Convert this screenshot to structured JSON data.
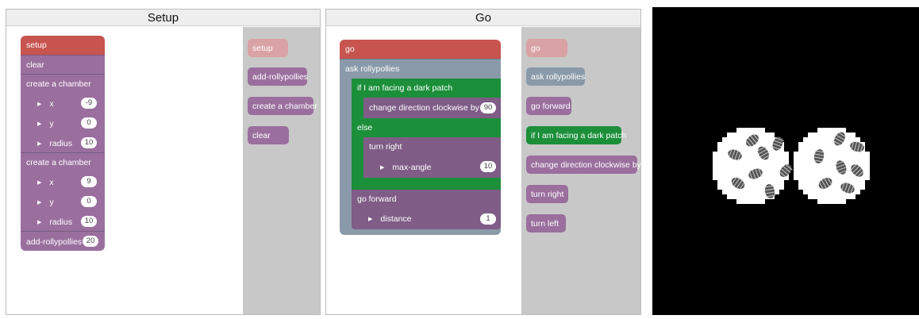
{
  "setup_pane": {
    "title": "Setup",
    "blocks": {
      "hat": "setup",
      "clear": "clear",
      "chamber1": {
        "label": "create a chamber",
        "x_label": "x",
        "x_val": "-9",
        "y_label": "y",
        "y_val": "0",
        "r_label": "radius",
        "r_val": "10"
      },
      "chamber2": {
        "label": "create a chamber",
        "x_label": "x",
        "x_val": "9",
        "y_label": "y",
        "y_val": "0",
        "r_label": "radius",
        "r_val": "10"
      },
      "add": {
        "label": "add-rollypollies",
        "val": "20"
      }
    },
    "flyout": [
      "setup",
      "add-rollypollies",
      "create a chamber",
      "clear"
    ]
  },
  "go_pane": {
    "title": "Go",
    "blocks": {
      "hat": "go",
      "ask": "ask rollypollies",
      "if": "if I am facing a dark patch",
      "change": {
        "label": "change direction clockwise by",
        "val": "90"
      },
      "else": "else",
      "turn_right": "turn right",
      "max_angle": {
        "label": "max-angle",
        "val": "10"
      },
      "forward": "go forward",
      "distance": {
        "label": "distance",
        "val": "1"
      }
    },
    "flyout": [
      "go",
      "ask rollypollies",
      "go forward",
      "if I am facing a dark patch",
      "change direction clockwise by",
      "turn right",
      "turn left"
    ]
  },
  "colors": {
    "purple": "#9a6f9e",
    "red": "#c7544f",
    "slate": "#8b9aaa",
    "green": "#1c8f3a",
    "flyout_bg": "#c8c8c8"
  }
}
